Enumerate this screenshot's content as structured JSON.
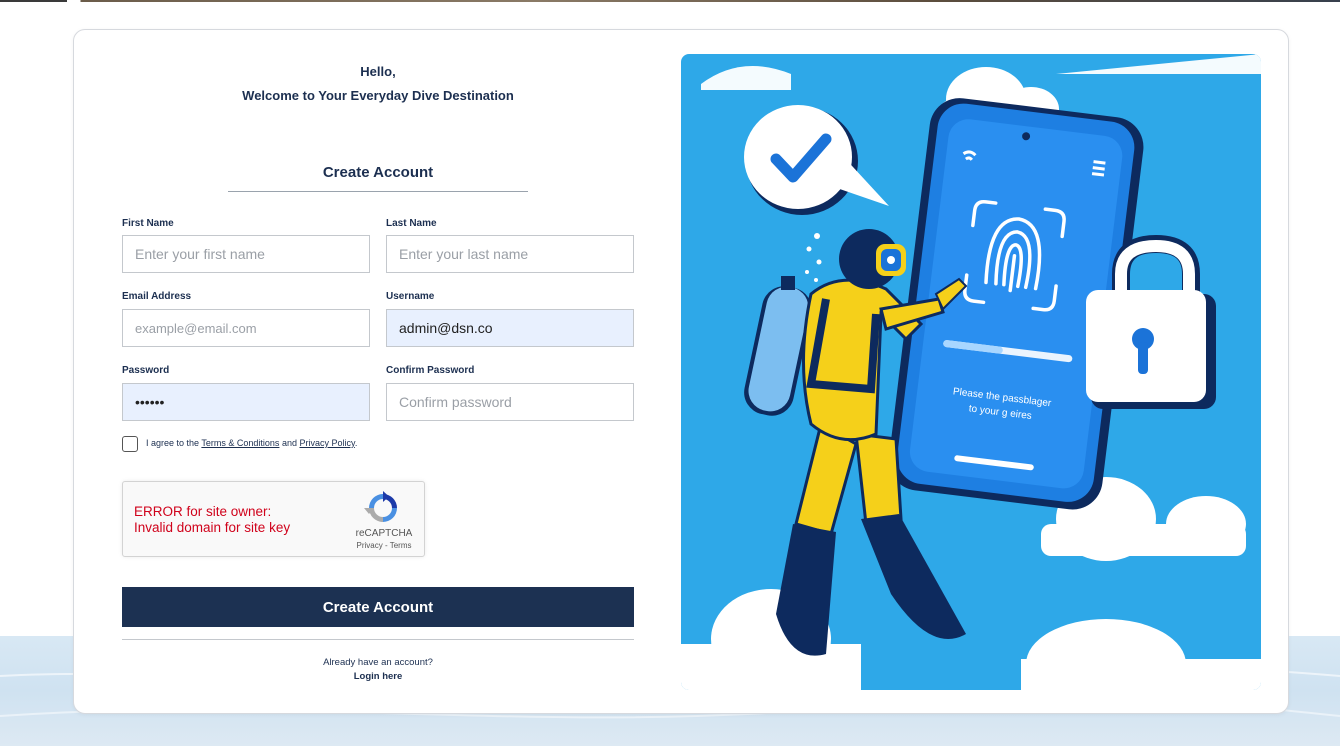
{
  "greeting": {
    "line1": "Hello,",
    "line2": "Welcome to Your Everyday Dive Destination"
  },
  "form": {
    "title": "Create Account",
    "fields": {
      "first_name": {
        "label": "First Name",
        "placeholder": "Enter your first name",
        "value": ""
      },
      "last_name": {
        "label": "Last Name",
        "placeholder": "Enter your last name",
        "value": ""
      },
      "email": {
        "label": "Email Address",
        "placeholder": "example@email.com",
        "value": ""
      },
      "username": {
        "label": "Username",
        "placeholder": "",
        "value": "admin@dsn.co"
      },
      "password": {
        "label": "Password",
        "placeholder": "",
        "value": "dsnpwd"
      },
      "confirm_password": {
        "label": "Confirm Password",
        "placeholder": "Confirm password",
        "value": ""
      }
    },
    "agree": {
      "prefix": "I agree to the",
      "terms": "Terms & Conditions",
      "and": "and",
      "privacy": "Privacy Policy",
      "suffix": ".",
      "checked": false
    },
    "captcha": {
      "error_line1": "ERROR for site owner:",
      "error_line2": "Invalid domain for site key",
      "brand": "reCAPTCHA",
      "privacy": "Privacy",
      "separator": " - ",
      "terms": "Terms"
    },
    "submit_label": "Create Account",
    "already": "Already have an account?",
    "login_label": "Login here"
  },
  "illustration": {
    "phone_text_line1": "Please the passblager",
    "phone_text_line2": "to your g eires"
  },
  "colors": {
    "primary": "#1c3152",
    "illustration_bg": "#2ea8e8",
    "error": "#d0021b",
    "filled_field": "#e8f0fe"
  }
}
